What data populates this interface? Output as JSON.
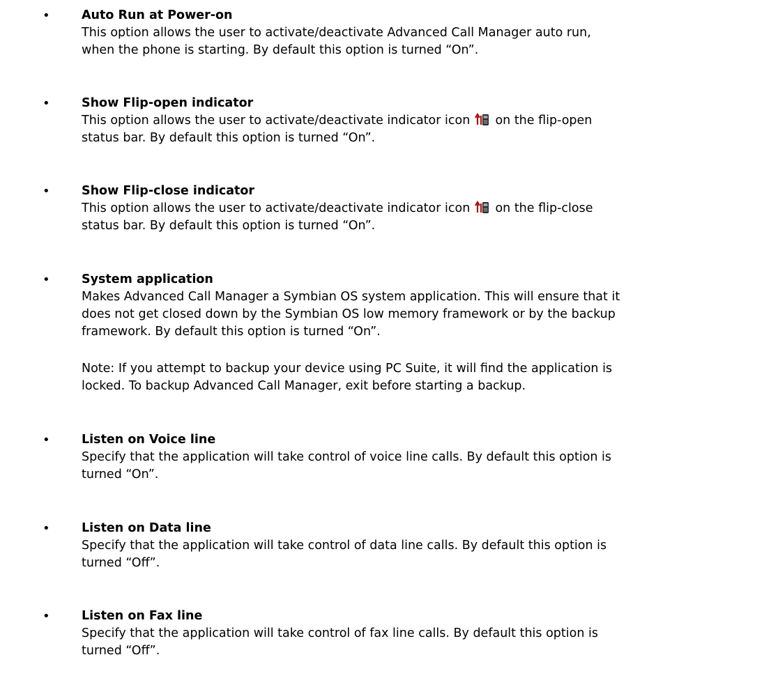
{
  "options": [
    {
      "title": "Auto Run at Power-on",
      "lines": [
        "This option allows the user to activate/deactivate Advanced Call Manager auto run,",
        "when the phone is starting. By default this option is turned “On”."
      ]
    },
    {
      "title": "Show Flip-open indicator",
      "line1_before": "This option allows the user to activate/deactivate indicator icon",
      "line1_after": "on the flip-open",
      "line2": "status bar. By default this option is turned “On”.",
      "icon": "flip-indicator-icon"
    },
    {
      "title": "Show Flip-close indicator",
      "line1_before": "This option allows the user to activate/deactivate indicator icon",
      "line1_after": "on the flip-close",
      "line2": "status bar. By default this option is turned “On”.",
      "icon": "flip-indicator-icon"
    },
    {
      "title": "System application",
      "lines": [
        "Makes Advanced Call Manager a Symbian OS system application.  This will ensure that it",
        "does not get closed down by the Symbian OS low memory framework or by the backup",
        "framework. By default this option is turned “On”."
      ],
      "note": [
        "Note: If you attempt to backup your device using PC Suite, it will find the application is",
        "locked. To backup Advanced Call Manager, exit before starting a backup."
      ]
    },
    {
      "title": "Listen on Voice line",
      "lines": [
        "Specify that the application will take control of voice line calls. By default this option is",
        "turned “On”."
      ]
    },
    {
      "title": "Listen on Data line",
      "lines": [
        "Specify that the application will take control of data line calls. By default this option is",
        "turned “Off”."
      ]
    },
    {
      "title": "Listen on Fax line",
      "lines": [
        "Specify that the application will take control of fax line calls. By default this option is",
        "turned “Off”."
      ]
    }
  ],
  "bullet_char": "•",
  "colors": {
    "text": "#000000",
    "icon_arrow": "#b01010",
    "icon_phone": "#2a2a2a"
  }
}
